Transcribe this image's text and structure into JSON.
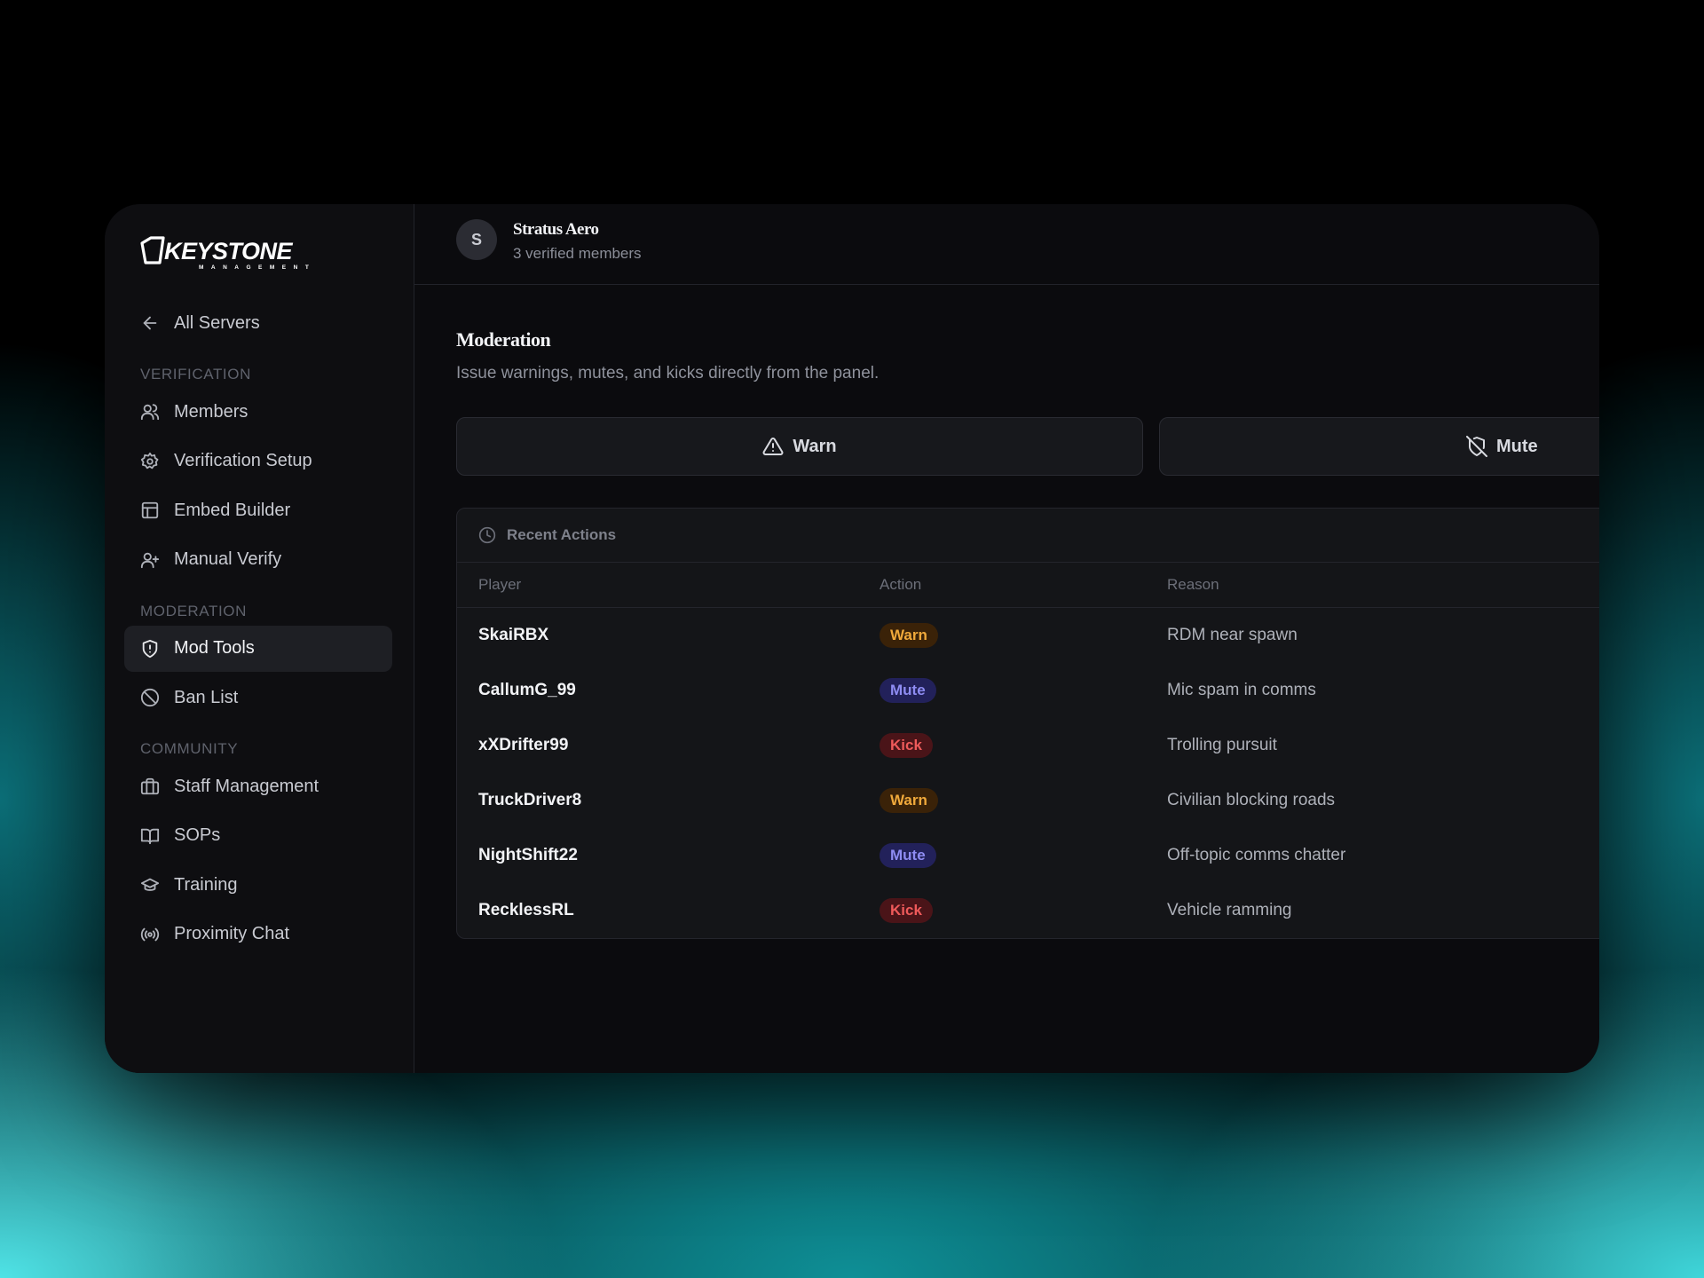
{
  "colors": {
    "accent_teal": "#3fd6da",
    "warn": "#f0a93b",
    "mute": "#8e8cf2",
    "kick": "#ee5a5a"
  },
  "sidebar": {
    "logo_text": "KEYSTONE",
    "logo_subtext": "MANAGEMENT",
    "back": {
      "label": "All Servers",
      "icon": "arrow-left-icon"
    },
    "sections": [
      {
        "label": "VERIFICATION",
        "items": [
          {
            "label": "Members",
            "icon": "users-icon"
          },
          {
            "label": "Verification Setup",
            "icon": "gear-icon"
          },
          {
            "label": "Embed Builder",
            "icon": "layout-icon"
          },
          {
            "label": "Manual Verify",
            "icon": "user-plus-icon"
          }
        ]
      },
      {
        "label": "MODERATION",
        "items": [
          {
            "label": "Mod Tools",
            "icon": "shield-icon",
            "active": true
          },
          {
            "label": "Ban List",
            "icon": "ban-icon"
          }
        ]
      },
      {
        "label": "COMMUNITY",
        "items": [
          {
            "label": "Staff Management",
            "icon": "briefcase-icon"
          },
          {
            "label": "SOPs",
            "icon": "book-icon"
          },
          {
            "label": "Training",
            "icon": "graduation-cap-icon"
          },
          {
            "label": "Proximity Chat",
            "icon": "radio-icon"
          }
        ]
      }
    ]
  },
  "header": {
    "avatar_letter": "S",
    "server_name": "Stratus Aero",
    "server_subtitle": "3 verified members"
  },
  "main": {
    "title": "Moderation",
    "description": "Issue warnings, mutes, and kicks directly from the panel.",
    "actions": [
      {
        "label": "Warn",
        "icon": "alert-triangle-icon"
      },
      {
        "label": "Mute",
        "icon": "shield-off-icon"
      }
    ],
    "recent": {
      "title": "Recent Actions",
      "icon": "clock-icon",
      "columns": [
        "Player",
        "Action",
        "Reason"
      ],
      "rows": [
        {
          "player": "SkaiRBX",
          "action": "Warn",
          "type": "warn",
          "reason": "RDM near spawn"
        },
        {
          "player": "CallumG_99",
          "action": "Mute",
          "type": "mute",
          "reason": "Mic spam in comms"
        },
        {
          "player": "xXDrifter99",
          "action": "Kick",
          "type": "kick",
          "reason": "Trolling pursuit"
        },
        {
          "player": "TruckDriver8",
          "action": "Warn",
          "type": "warn",
          "reason": "Civilian blocking roads"
        },
        {
          "player": "NightShift22",
          "action": "Mute",
          "type": "mute",
          "reason": "Off-topic comms chatter"
        },
        {
          "player": "RecklessRL",
          "action": "Kick",
          "type": "kick",
          "reason": "Vehicle ramming"
        }
      ]
    }
  }
}
